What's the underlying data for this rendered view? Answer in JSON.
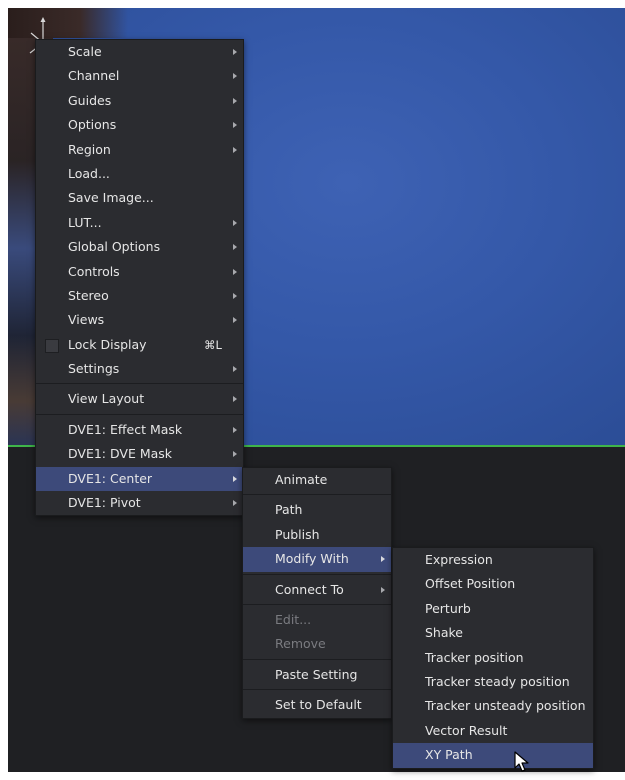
{
  "main_menu": {
    "items": [
      {
        "label": "Scale",
        "submenu": true
      },
      {
        "label": "Channel",
        "submenu": true
      },
      {
        "label": "Guides",
        "submenu": true
      },
      {
        "label": "Options",
        "submenu": true
      },
      {
        "label": "Region",
        "submenu": true
      },
      {
        "label": "Load...",
        "submenu": false
      },
      {
        "label": "Save Image...",
        "submenu": false
      },
      {
        "label": "LUT...",
        "submenu": true
      },
      {
        "label": "Global Options",
        "submenu": true
      },
      {
        "label": "Controls",
        "submenu": true
      },
      {
        "label": "Stereo",
        "submenu": true
      },
      {
        "label": "Views",
        "submenu": true
      },
      {
        "label": "Lock Display",
        "shortcut": "⌘L",
        "checkbox": true
      },
      {
        "label": "Settings",
        "submenu": true
      },
      {
        "label": "View Layout",
        "submenu": true
      },
      {
        "label": "DVE1: Effect Mask",
        "submenu": true
      },
      {
        "label": "DVE1: DVE Mask",
        "submenu": true
      },
      {
        "label": "DVE1: Center",
        "submenu": true,
        "highlighted": true
      },
      {
        "label": "DVE1: Pivot",
        "submenu": true
      }
    ]
  },
  "center_menu": {
    "items": [
      {
        "label": "Animate"
      },
      {
        "label": "Path"
      },
      {
        "label": "Publish"
      },
      {
        "label": "Modify With",
        "submenu": true,
        "highlighted": true
      },
      {
        "label": "Connect To",
        "submenu": true
      },
      {
        "label": "Edit...",
        "disabled": true
      },
      {
        "label": "Remove",
        "disabled": true
      },
      {
        "label": "Paste Setting"
      },
      {
        "label": "Set to Default"
      }
    ]
  },
  "modify_menu": {
    "items": [
      {
        "label": "Expression"
      },
      {
        "label": "Offset Position"
      },
      {
        "label": "Perturb"
      },
      {
        "label": "Shake"
      },
      {
        "label": "Tracker position"
      },
      {
        "label": "Tracker steady position"
      },
      {
        "label": "Tracker unsteady position"
      },
      {
        "label": "Vector Result"
      },
      {
        "label": "XY Path",
        "highlighted": true
      }
    ]
  },
  "colors": {
    "menu_bg": "#2b2c30",
    "highlight": "#3d4a7a",
    "viewer_border": "#3fb54a",
    "image_blue": "#3458a8"
  },
  "icons": {
    "transform_widget": "transform-gizmo-icon",
    "pointer": "mouse-pointer-icon"
  }
}
